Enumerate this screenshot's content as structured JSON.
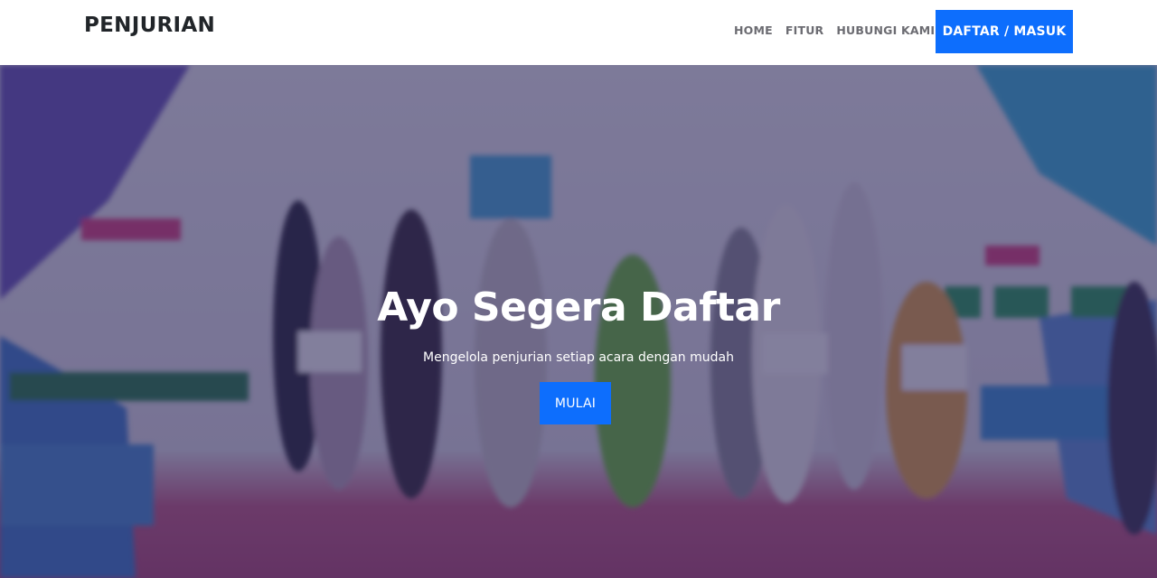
{
  "navbar": {
    "brand": "PENJURIAN",
    "links": [
      "HOME",
      "FITUR",
      "HUBUNGI KAMI"
    ],
    "cta_label": "DAFTAR / MASUK"
  },
  "hero": {
    "title": "Ayo Segera Daftar",
    "subtitle": "Mengelola penjurian setiap acara dengan mudah",
    "button_label": "MULAI"
  },
  "colors": {
    "primary": "#0d6efd",
    "navbar_bg": "#ffffff",
    "brand_text": "#212529",
    "nav_link": "#6c6c72",
    "overlay": "#242054"
  }
}
